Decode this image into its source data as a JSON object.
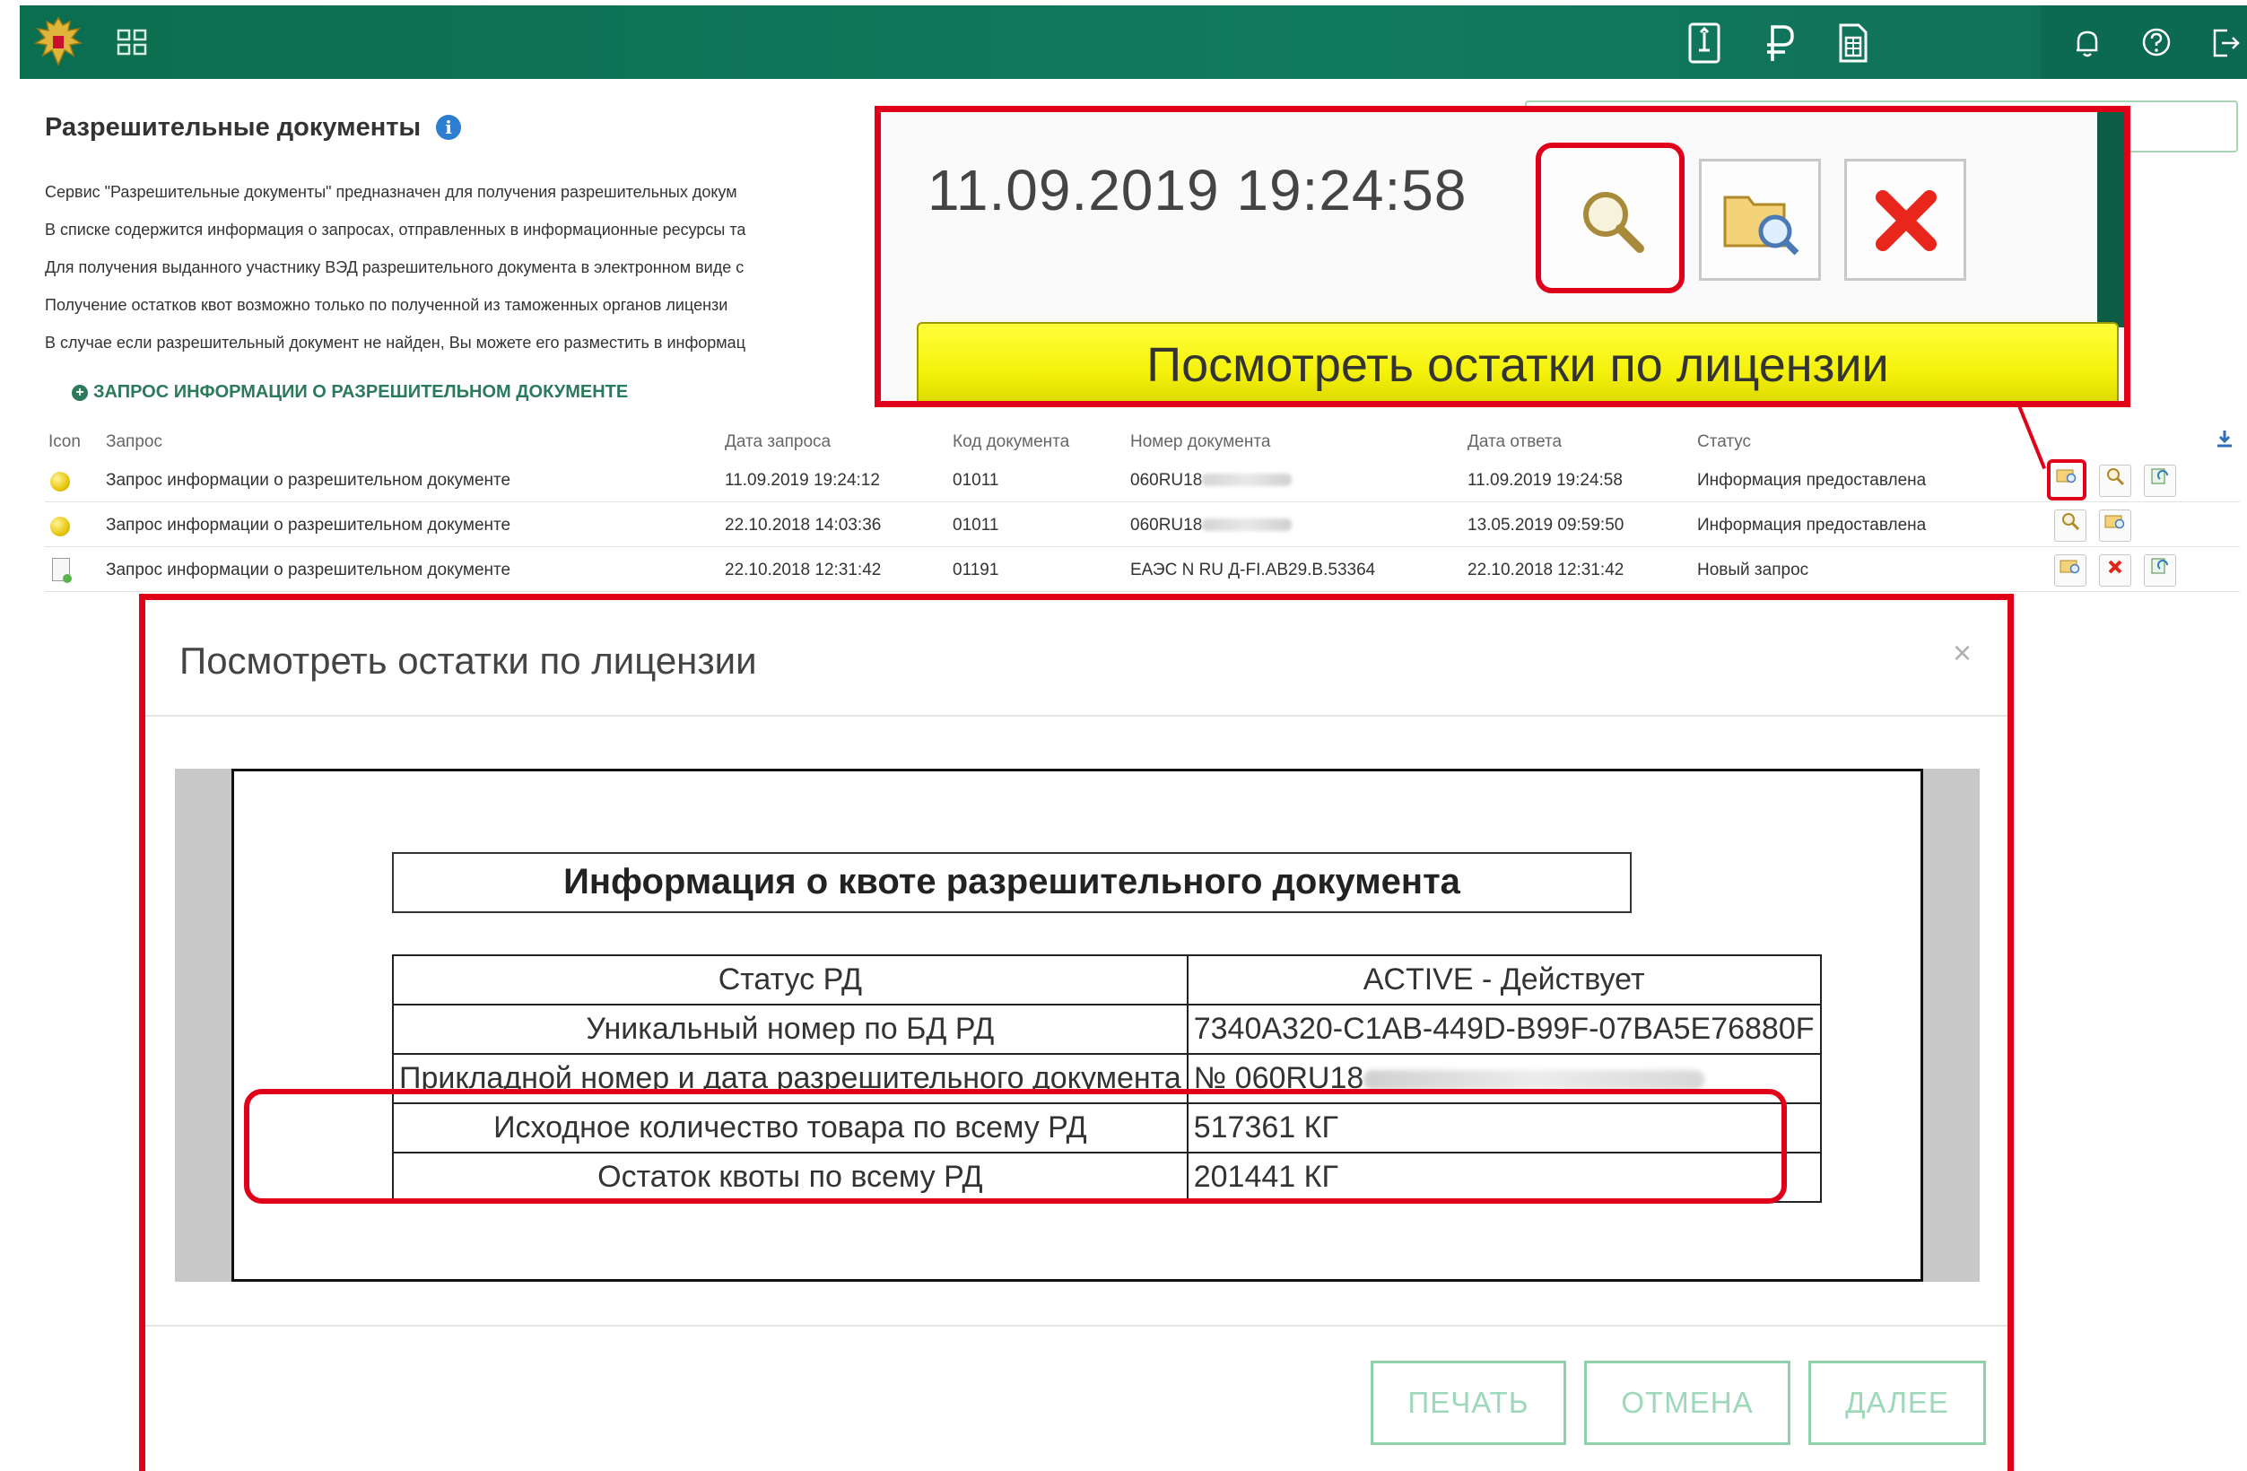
{
  "header": {
    "icons": [
      "emblem-icon",
      "apps-grid-icon",
      "book-icon",
      "ruble-icon",
      "calculator-doc-icon",
      "bell-icon",
      "help-icon",
      "logout-icon"
    ]
  },
  "page": {
    "title": "Разрешительные документы",
    "description_lines": [
      "Сервис \"Разрешительные документы\" предназначен для получения разрешительных докум",
      "В списке содержится информация о запросах, отправленных в информационные ресурсы та",
      "Для получения выданного участнику ВЭД разрешительного документа в электронном виде с",
      "Получение остатков квот возможно только по полученной из таможенных органов лицензи",
      "В случае если разрешительный документ не найден, Вы можете его разместить в информац"
    ],
    "request_link": "ЗАПРОС ИНФОРМАЦИИ О РАЗРЕШИТЕЛЬНОМ ДОКУМЕНТЕ"
  },
  "table": {
    "headers": [
      "Icon",
      "Запрос",
      "Дата запроса",
      "Код документа",
      "Номер документа",
      "Дата ответа",
      "Статус"
    ],
    "rows": [
      {
        "request": "Запрос информации о разрешительном документе",
        "request_date": "11.09.2019 19:24:12",
        "code": "01011",
        "number": "060RU18",
        "answer_date": "11.09.2019 19:24:58",
        "status": "Информация предоставлена"
      },
      {
        "request": "Запрос информации о разрешительном документе",
        "request_date": "22.10.2018 14:03:36",
        "code": "01011",
        "number": "060RU18",
        "answer_date": "13.05.2019 09:59:50",
        "status": "Информация предоставлена"
      },
      {
        "request": "Запрос информации о разрешительном документе",
        "request_date": "22.10.2018 12:31:42",
        "code": "01191",
        "number": "ЕАЭС N RU Д-FI.AB29.B.53364",
        "answer_date": "22.10.2018 12:31:42",
        "status": "Новый запрос"
      }
    ]
  },
  "callout": {
    "date": "11.09.2019 19:24:58",
    "tooltip": "Посмотреть остатки по лицензии"
  },
  "modal": {
    "title": "Посмотреть остатки по лицензии",
    "close": "×",
    "doc_title": "Информация о квоте разрешительного документа",
    "rows": [
      {
        "key": "Статус РД",
        "value": "ACTIVE - Действует"
      },
      {
        "key": "Уникальный номер по БД РД",
        "value": "7340A320-C1AB-449D-B99F-07BA5E76880F"
      },
      {
        "key": "Прикладной номер и дата разрешительного документа",
        "value": "№ 060RU18"
      },
      {
        "key": "Исходное количество товара по всему РД",
        "value": "517361 КГ"
      },
      {
        "key": "Остаток квоты по всему РД",
        "value": "201441 КГ"
      }
    ],
    "buttons": {
      "print": "ПЕЧАТЬ",
      "cancel": "ОТМЕНА",
      "next": "ДАЛЕЕ"
    }
  },
  "colors": {
    "header_green": "#127a5e",
    "highlight_red": "#e0001a",
    "tooltip_yellow": "#f4f10a",
    "button_green": "#8fd0ad"
  }
}
